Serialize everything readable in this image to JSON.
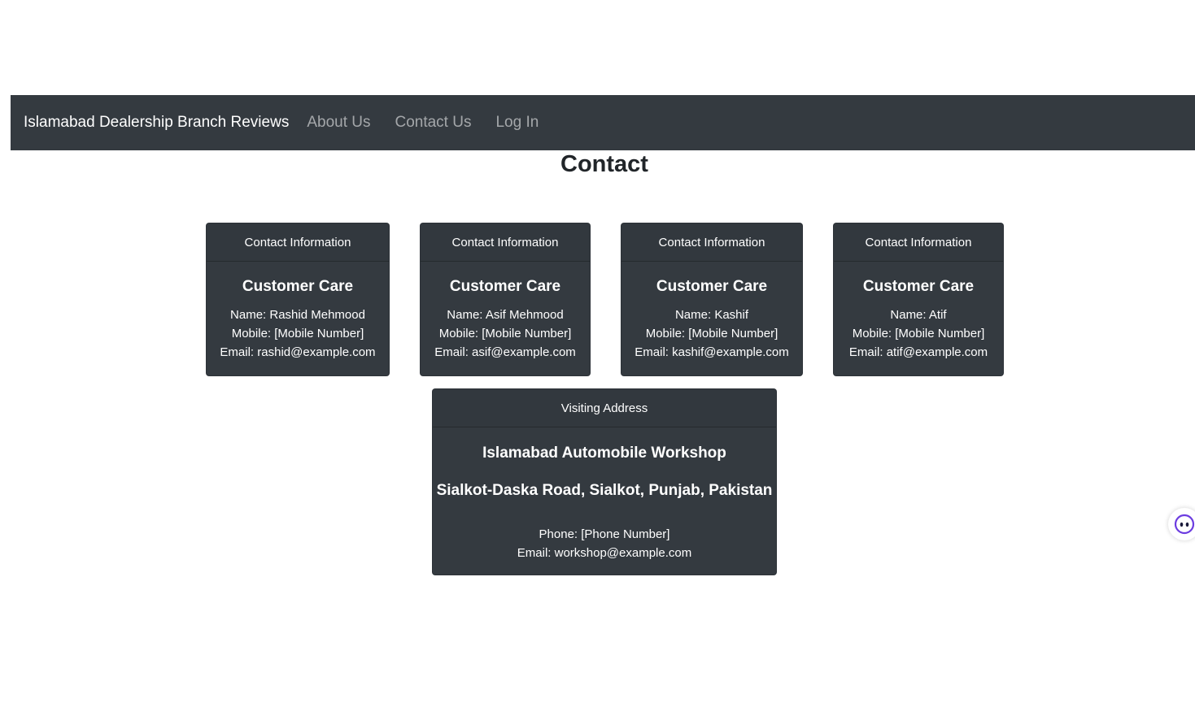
{
  "navbar": {
    "brand": "Islamabad Dealership Branch Reviews",
    "links": [
      {
        "label": "About Us"
      },
      {
        "label": "Contact Us"
      },
      {
        "label": "Log In"
      }
    ]
  },
  "page_title": "Contact",
  "contacts": [
    {
      "header": "Contact Information",
      "title": "Customer Care",
      "name": "Name: Rashid Mehmood",
      "mobile": "Mobile: [Mobile Number]",
      "email": "Email: rashid@example.com"
    },
    {
      "header": "Contact Information",
      "title": "Customer Care",
      "name": "Name: Asif Mehmood",
      "mobile": "Mobile: [Mobile Number]",
      "email": "Email: asif@example.com"
    },
    {
      "header": "Contact Information",
      "title": "Customer Care",
      "name": "Name: Kashif",
      "mobile": "Mobile: [Mobile Number]",
      "email": "Email: kashif@example.com"
    },
    {
      "header": "Contact Information",
      "title": "Customer Care",
      "name": "Name: Atif",
      "mobile": "Mobile: [Mobile Number]",
      "email": "Email: atif@example.com"
    }
  ],
  "address": {
    "header": "Visiting Address",
    "title": "Islamabad Automobile Workshop",
    "location": "Sialkot-Daska Road, Sialkot, Punjab, Pakistan",
    "phone": "Phone: [Phone Number]",
    "email": "Email: workshop@example.com"
  },
  "assistant_button": {
    "icon": "assistant-face-icon"
  },
  "colors": {
    "navbar_bg": "#343a40",
    "card_bg": "#343a40",
    "link_muted": "rgba(255,255,255,0.55)",
    "assistant_accent": "#6c3ce0"
  }
}
